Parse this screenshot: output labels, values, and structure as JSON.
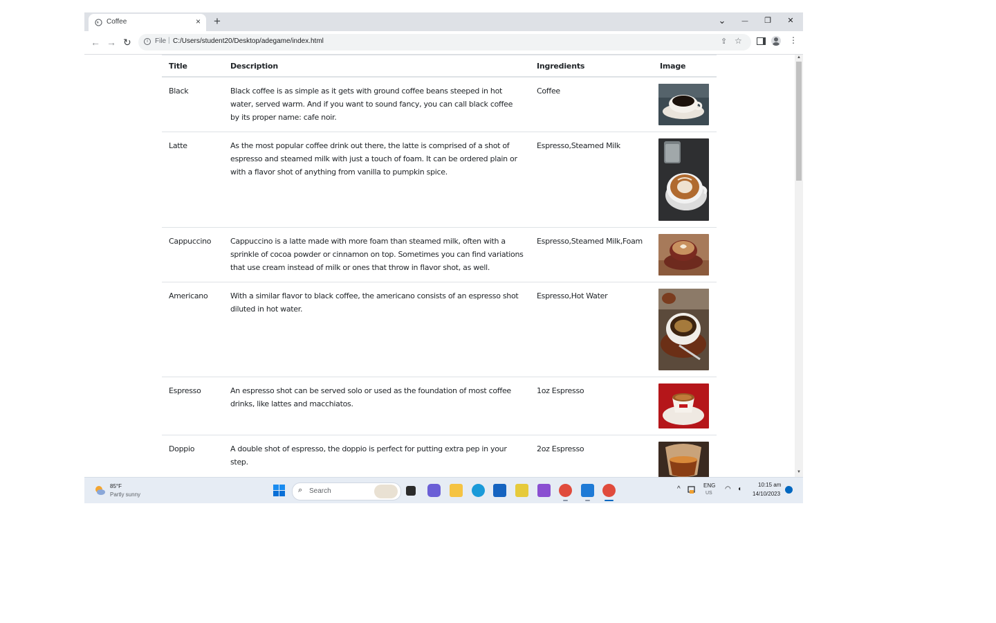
{
  "browser": {
    "tab_title": "Coffee",
    "tab_close": "×",
    "new_tab": "+",
    "window_controls": {
      "tab_search": "⌄",
      "minimize": "—",
      "restore": "❐",
      "close": "✕"
    },
    "nav": {
      "back": "←",
      "forward": "→",
      "reload": "↻"
    },
    "address": {
      "info_icon": "i",
      "scheme_label": "File",
      "separator": "|",
      "url": "C:/Users/student20/Desktop/adegame/index.html"
    },
    "share_icon": "⇪",
    "bookmark_icon": "☆",
    "menu_icon": "⋮"
  },
  "table": {
    "headers": {
      "title": "Title",
      "description": "Description",
      "ingredients": "Ingredients",
      "image": "Image"
    },
    "rows": [
      {
        "title": "Black",
        "description": "Black coffee is as simple as it gets with ground coffee beans steeped in hot water, served warm. And if you want to sound fancy, you can call black coffee by its proper name: cafe noir.",
        "ingredients": "Coffee",
        "image_icon": "coffee-cup-black-photo"
      },
      {
        "title": "Latte",
        "description": "As the most popular coffee drink out there, the latte is comprised of a shot of espresso and steamed milk with just a touch of foam. It can be ordered plain or with a flavor shot of anything from vanilla to pumpkin spice.",
        "ingredients": "Espresso,Steamed Milk",
        "image_icon": "latte-art-photo"
      },
      {
        "title": "Cappuccino",
        "description": "Cappuccino is a latte made with more foam than steamed milk, often with a sprinkle of cocoa powder or cinnamon on top. Sometimes you can find variations that use cream instead of milk or ones that throw in flavor shot, as well.",
        "ingredients": "Espresso,Steamed Milk,Foam",
        "image_icon": "cappuccino-photo"
      },
      {
        "title": "Americano",
        "description": "With a similar flavor to black coffee, the americano consists of an espresso shot diluted in hot water.",
        "ingredients": "Espresso,Hot Water",
        "image_icon": "americano-photo"
      },
      {
        "title": "Espresso",
        "description": "An espresso shot can be served solo or used as the foundation of most coffee drinks, like lattes and macchiatos.",
        "ingredients": "1oz Espresso",
        "image_icon": "espresso-photo"
      },
      {
        "title": "Doppio",
        "description": "A double shot of espresso, the doppio is perfect for putting extra pep in your step.",
        "ingredients": "2oz Espresso",
        "image_icon": "doppio-photo"
      }
    ]
  },
  "taskbar": {
    "weather_temp": "85°F",
    "weather_desc": "Partly sunny",
    "search_label": "Search",
    "search_icon": "⌕",
    "tray_chevron": "^",
    "language": "ENG",
    "locale": "US",
    "wifi_icon": "◠",
    "sound_icon": "◖",
    "time": "10:15 am",
    "date": "14/10/2023"
  },
  "colors": {
    "accent": "#0067c0",
    "tabstrip": "#dee1e6",
    "taskbar": "#e6ecf4"
  }
}
